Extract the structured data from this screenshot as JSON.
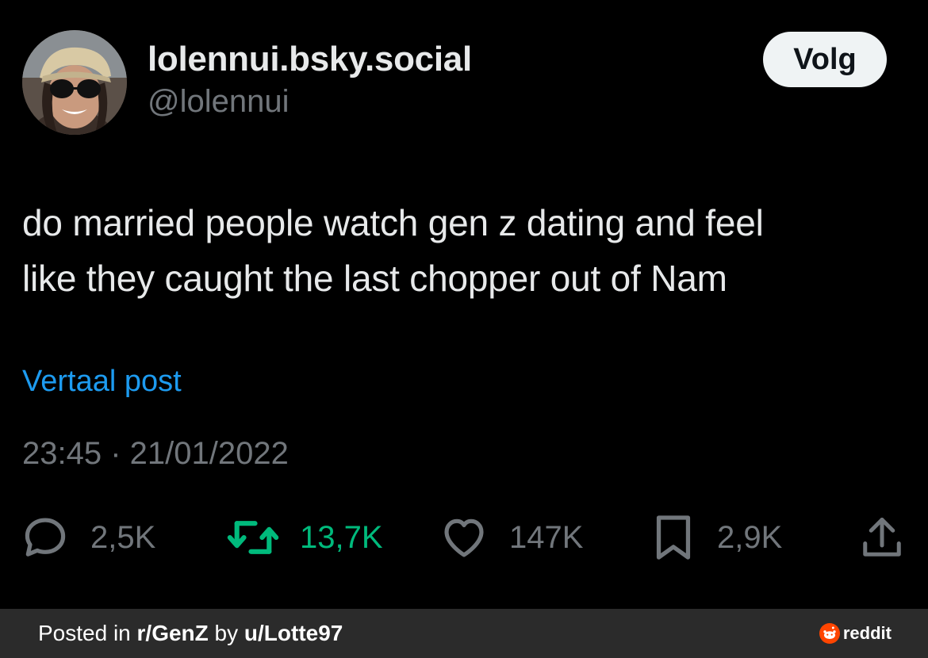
{
  "author": {
    "display_name": "lolennui.bsky.social",
    "handle": "@lolennui"
  },
  "follow_button": {
    "label": "Volg"
  },
  "post": {
    "text": "do married people watch gen z dating and feel\nlike they caught the last chopper out of Nam",
    "translate_label": "Vertaal post",
    "timestamp": "23:45 · 21/01/2022"
  },
  "actions": {
    "replies": {
      "icon": "comment-icon",
      "count": "2,5K"
    },
    "reposts": {
      "icon": "repost-icon",
      "count": "13,7K",
      "color": "#00ba7c"
    },
    "likes": {
      "icon": "heart-icon",
      "count": "147K"
    },
    "bookmarks": {
      "icon": "bookmark-icon",
      "count": "2,9K"
    },
    "share": {
      "icon": "share-icon"
    }
  },
  "footer": {
    "prefix": "Posted in ",
    "subreddit": "r/GenZ",
    "middle": " by ",
    "user": "u/Lotte97",
    "brand": "reddit",
    "brand_color": "#ff4500"
  },
  "colors": {
    "background": "#000000",
    "text": "#e7e9ea",
    "muted": "#71767b",
    "link": "#1d9bf0",
    "repost": "#00ba7c"
  }
}
